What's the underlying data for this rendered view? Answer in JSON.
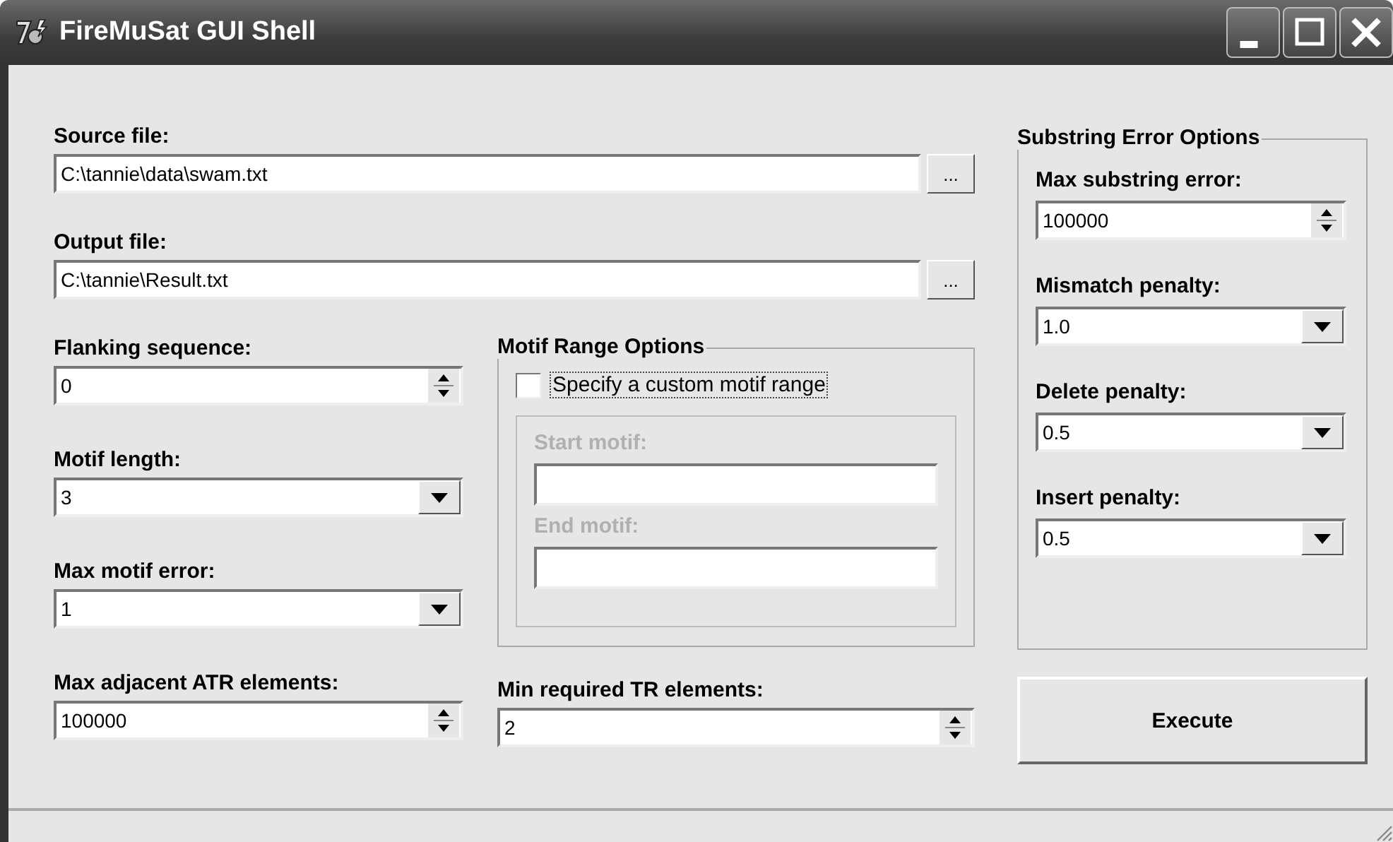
{
  "window": {
    "title": "FireMuSat GUI Shell"
  },
  "source_file": {
    "label": "Source file:",
    "value": "C:\\tannie\\data\\swam.txt",
    "browse": "..."
  },
  "output_file": {
    "label": "Output file:",
    "value": "C:\\tannie\\Result.txt",
    "browse": "..."
  },
  "left_fields": [
    {
      "kind": "spinner",
      "label": "Flanking sequence:",
      "value": "0"
    },
    {
      "kind": "combo",
      "label": "Motif length:",
      "value": "3"
    },
    {
      "kind": "combo",
      "label": "Max motif error:",
      "value": "1"
    },
    {
      "kind": "spinner",
      "label": "Max adjacent ATR elements:",
      "value": "100000"
    }
  ],
  "motif_range": {
    "title": "Motif Range Options",
    "checkbox": {
      "label": "Specify a custom motif range",
      "checked": false
    },
    "disabled": true,
    "fields": [
      {
        "label": "Start motif:"
      },
      {
        "label": "End motif:"
      }
    ]
  },
  "min_required": {
    "kind": "spinner",
    "label": "Min required TR elements:",
    "value": "2"
  },
  "substring_options": {
    "title": "Substring Error Options",
    "fields": [
      {
        "kind": "spinner",
        "label": "Max substring error:",
        "value": "100000"
      },
      {
        "kind": "combo",
        "label": "Mismatch penalty:",
        "value": "1.0"
      },
      {
        "kind": "combo",
        "label": "Delete penalty:",
        "value": "0.5"
      },
      {
        "kind": "combo",
        "label": "Insert penalty:",
        "value": "0.5"
      }
    ]
  },
  "execute_button": "Execute"
}
